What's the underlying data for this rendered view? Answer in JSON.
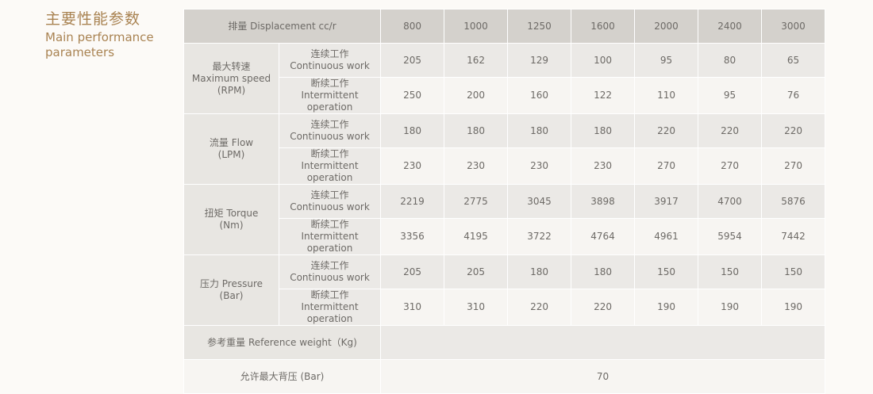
{
  "heading": {
    "cn": "主要性能参数",
    "en": "Main performance parameters"
  },
  "table": {
    "header_label": "排量 Displacement  cc/r",
    "displacements": [
      "800",
      "1000",
      "1250",
      "1600",
      "2000",
      "2400",
      "3000"
    ],
    "continuous": {
      "cn": "连续工作",
      "en": "Continuous work"
    },
    "intermittent": {
      "cn": "断续工作",
      "en": "Intermittent operation"
    },
    "params": [
      {
        "name_cn": "最大转速",
        "name_en": "Maximum speed",
        "unit": "(RPM)",
        "continuous": [
          "205",
          "162",
          "129",
          "100",
          "95",
          "80",
          "65"
        ],
        "intermittent": [
          "250",
          "200",
          "160",
          "122",
          "110",
          "95",
          "76"
        ]
      },
      {
        "name_cn": "流量 Flow",
        "name_en": "",
        "unit": "(LPM)",
        "continuous": [
          "180",
          "180",
          "180",
          "180",
          "220",
          "220",
          "220"
        ],
        "intermittent": [
          "230",
          "230",
          "230",
          "230",
          "270",
          "270",
          "270"
        ]
      },
      {
        "name_cn": "扭矩 Torque",
        "name_en": "",
        "unit": "(Nm)",
        "continuous": [
          "2219",
          "2775",
          "3045",
          "3898",
          "3917",
          "4700",
          "5876"
        ],
        "intermittent": [
          "3356",
          "4195",
          "3722",
          "4764",
          "4961",
          "5954",
          "7442"
        ]
      },
      {
        "name_cn": "压力 Pressure",
        "name_en": "",
        "unit": "(Bar)",
        "continuous": [
          "205",
          "205",
          "180",
          "180",
          "150",
          "150",
          "150"
        ],
        "intermittent": [
          "310",
          "310",
          "220",
          "220",
          "190",
          "190",
          "190"
        ]
      }
    ],
    "weight_label": "参考重量 Reference weight（Kg)",
    "weight_value": "",
    "back_pressure_label": "允许最大背压 (Bar)",
    "back_pressure_value": "70"
  }
}
